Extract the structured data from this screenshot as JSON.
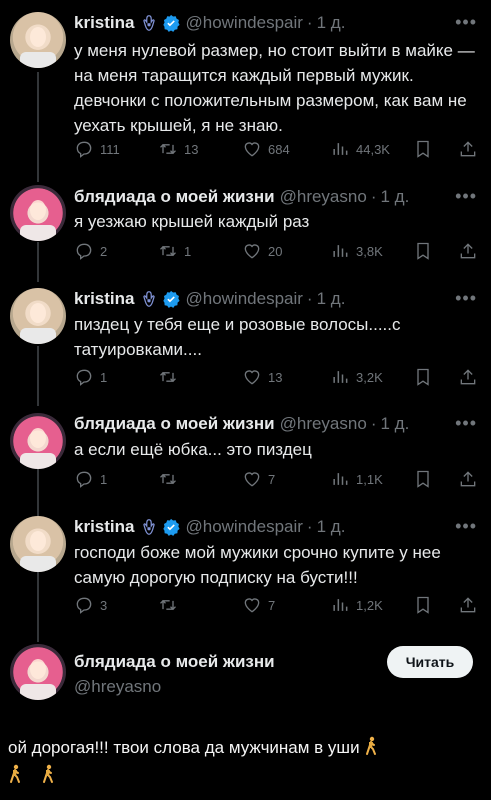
{
  "tweets": [
    {
      "name": "kristina",
      "handle": "@howindespair",
      "dot": "·",
      "time": "1 д.",
      "text": "у меня нулевой размер, но стоит выйти в майке — на меня таращится каждый первый мужик. девчонки с положительным размером, как вам не уехать крышей, я не знаю.",
      "replies": "111",
      "retweets": "13",
      "likes": "684",
      "views": "44,3K",
      "verified": true
    },
    {
      "name": "блядиада о моей жизни",
      "handle": "@hreyasno",
      "dot": "·",
      "time": "1 д.",
      "text": "я уезжаю крышей каждый раз",
      "replies": "2",
      "retweets": "1",
      "likes": "20",
      "views": "3,8K",
      "verified": false
    },
    {
      "name": "kristina",
      "handle": "@howindespair",
      "dot": "·",
      "time": "1 д.",
      "text": "пиздец у тебя еще и розовые волосы.....с татуировками....",
      "replies": "1",
      "retweets": "",
      "likes": "13",
      "views": "3,2K",
      "verified": true
    },
    {
      "name": "блядиада о моей жизни",
      "handle": "@hreyasno",
      "dot": "·",
      "time": "1 д.",
      "text": "а если ещё юбка... это пиздец",
      "replies": "1",
      "retweets": "",
      "likes": "7",
      "views": "1,1K",
      "verified": false
    },
    {
      "name": "kristina",
      "handle": "@howindespair",
      "dot": "·",
      "time": "1 д.",
      "text": "господи боже мой мужики срочно купите у нее самую дорогую подписку на бусти!!!",
      "replies": "3",
      "retweets": "",
      "likes": "7",
      "views": "1,2K",
      "verified": true
    }
  ],
  "profile": {
    "name": "блядиада о моей жизни",
    "handle": "@hreyasno",
    "follow_label": "Читать"
  },
  "caption": {
    "text": "ой дорогая!!! твои слова да мужчинам в уши"
  },
  "icons": {
    "reply": "reply-icon",
    "retweet": "retweet-icon",
    "like": "heart-icon",
    "views": "views-icon",
    "bookmark": "bookmark-icon",
    "share": "share-icon",
    "more": "more-icon",
    "verified": "verified-badge-icon",
    "hamsa": "hamsa-icon",
    "emoji": "person-walking-emoji-icon"
  },
  "colors": {
    "background": "#000000",
    "text": "#e7e9ea",
    "muted": "#71767b",
    "verified": "#1d9bf0",
    "hamsa": "#6a7fc9"
  }
}
